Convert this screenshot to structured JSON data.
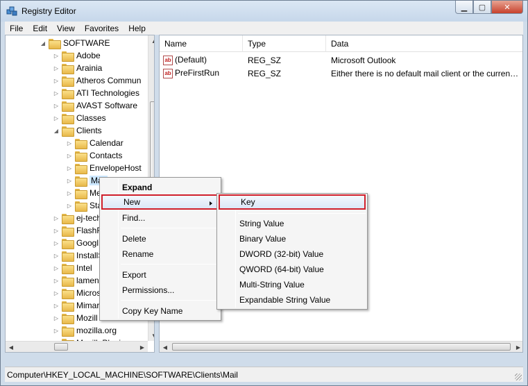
{
  "window": {
    "title": "Registry Editor"
  },
  "menu": [
    "File",
    "Edit",
    "View",
    "Favorites",
    "Help"
  ],
  "tree": {
    "root": {
      "label": "SOFTWARE",
      "expanded": true
    },
    "items": [
      {
        "label": "Adobe",
        "expanded": false
      },
      {
        "label": "Arainia",
        "expanded": false
      },
      {
        "label": "Atheros Commun",
        "expanded": false
      },
      {
        "label": "ATI Technologies",
        "expanded": false
      },
      {
        "label": "AVAST Software",
        "expanded": false
      },
      {
        "label": "Classes",
        "expanded": false
      },
      {
        "label": "Clients",
        "expanded": true
      }
    ],
    "client_children": [
      {
        "label": "Calendar"
      },
      {
        "label": "Contacts"
      },
      {
        "label": "EnvelopeHost"
      },
      {
        "label": "Mail",
        "selected": true
      },
      {
        "label": "Me"
      },
      {
        "label": "Sta"
      }
    ],
    "more_items": [
      {
        "label": "ej-tech"
      },
      {
        "label": "FlashF"
      },
      {
        "label": "Googl"
      },
      {
        "label": "InstallS"
      },
      {
        "label": "Intel"
      },
      {
        "label": "lamen"
      },
      {
        "label": "Micros"
      },
      {
        "label": "Mimar"
      },
      {
        "label": "Mozill"
      },
      {
        "label": "mozilla.org"
      },
      {
        "label": "MozillaPlugins"
      }
    ]
  },
  "list": {
    "columns": [
      "Name",
      "Type",
      "Data"
    ],
    "rows": [
      {
        "name": "(Default)",
        "type": "REG_SZ",
        "data": "Microsoft Outlook",
        "icon": "string-value-icon"
      },
      {
        "name": "PreFirstRun",
        "type": "REG_SZ",
        "data": "Either there is no default mail client or the current ...",
        "icon": "string-value-icon"
      }
    ]
  },
  "context_menu": {
    "items": [
      {
        "label": "Expand",
        "bold": true
      },
      {
        "label": "New",
        "submenu": true,
        "highlighted": true
      },
      {
        "label": "Find..."
      },
      {
        "label": "Delete"
      },
      {
        "label": "Rename"
      },
      {
        "label": "Export"
      },
      {
        "label": "Permissions..."
      },
      {
        "label": "Copy Key Name"
      }
    ]
  },
  "new_submenu": {
    "items": [
      {
        "label": "Key",
        "highlighted": true
      },
      {
        "label": "String Value"
      },
      {
        "label": "Binary Value"
      },
      {
        "label": "DWORD (32-bit) Value"
      },
      {
        "label": "QWORD (64-bit) Value"
      },
      {
        "label": "Multi-String Value"
      },
      {
        "label": "Expandable String Value"
      }
    ]
  },
  "status": {
    "path": "Computer\\HKEY_LOCAL_MACHINE\\SOFTWARE\\Clients\\Mail"
  },
  "colors": {
    "highlight_border": "#d01f2b",
    "selection": "#cde8ff",
    "chrome": "#cfdcea"
  }
}
